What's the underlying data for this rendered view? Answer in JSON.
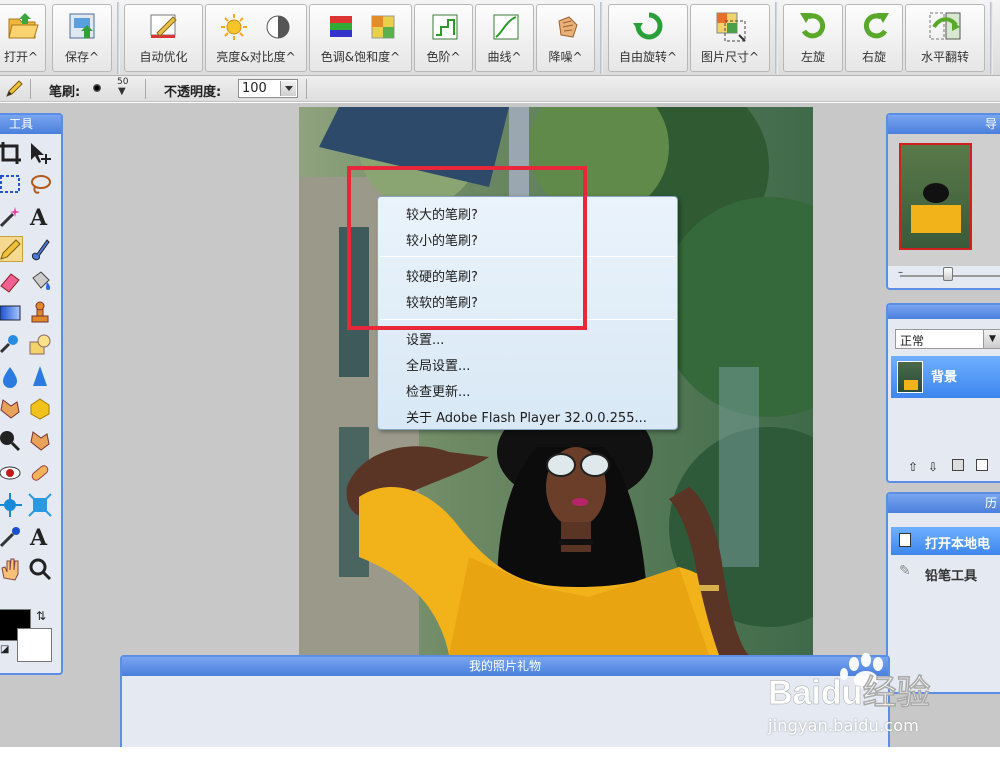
{
  "toolbar": {
    "buttons": [
      {
        "label": "打开^",
        "icon": "folder-open-icon"
      },
      {
        "label": "保存^",
        "icon": "save-icon"
      },
      {
        "label": "自动优化",
        "icon": "auto-fix-icon"
      },
      {
        "label": "亮度&对比度^",
        "icon": "brightness-contrast-icon"
      },
      {
        "label": "色调&饱和度^",
        "icon": "hue-saturation-icon"
      },
      {
        "label": "色阶^",
        "icon": "levels-icon"
      },
      {
        "label": "曲线^",
        "icon": "curves-icon"
      },
      {
        "label": "降噪^",
        "icon": "denoise-icon"
      },
      {
        "label": "自由旋转^",
        "icon": "free-rotate-icon"
      },
      {
        "label": "图片尺寸^",
        "icon": "image-size-icon"
      },
      {
        "label": "左旋",
        "icon": "rotate-left-icon"
      },
      {
        "label": "右旋",
        "icon": "rotate-right-icon"
      },
      {
        "label": "水平翻转",
        "icon": "flip-horizontal-icon"
      }
    ]
  },
  "options": {
    "brush_label": "笔刷:",
    "brush_size": "50",
    "opacity_label": "不透明度:",
    "opacity_value": "100"
  },
  "tools_panel": {
    "title": "工具"
  },
  "context_menu": {
    "items": [
      "较大的笔刷?",
      "较小的笔刷?",
      "较硬的笔刷?",
      "较软的笔刷?",
      "设置...",
      "全局设置...",
      "检查更新...",
      "关于 Adobe Flash Player 32.0.0.255..."
    ]
  },
  "navigator_panel": {
    "title": "导"
  },
  "layers_panel": {
    "blend_mode": "正常",
    "layer_name": "背景"
  },
  "history_panel": {
    "title": "历",
    "items": [
      "打开本地电",
      "铅笔工具"
    ]
  },
  "bottom_panel": {
    "title": "我的照片礼物"
  },
  "watermark": {
    "brand": "Baidu经验",
    "url": "jingyan.baidu.com"
  },
  "colors": {
    "panel_border": "#5b8ee4",
    "highlight": "#e8283a",
    "foreground": "#000000",
    "background": "#ffffff"
  }
}
